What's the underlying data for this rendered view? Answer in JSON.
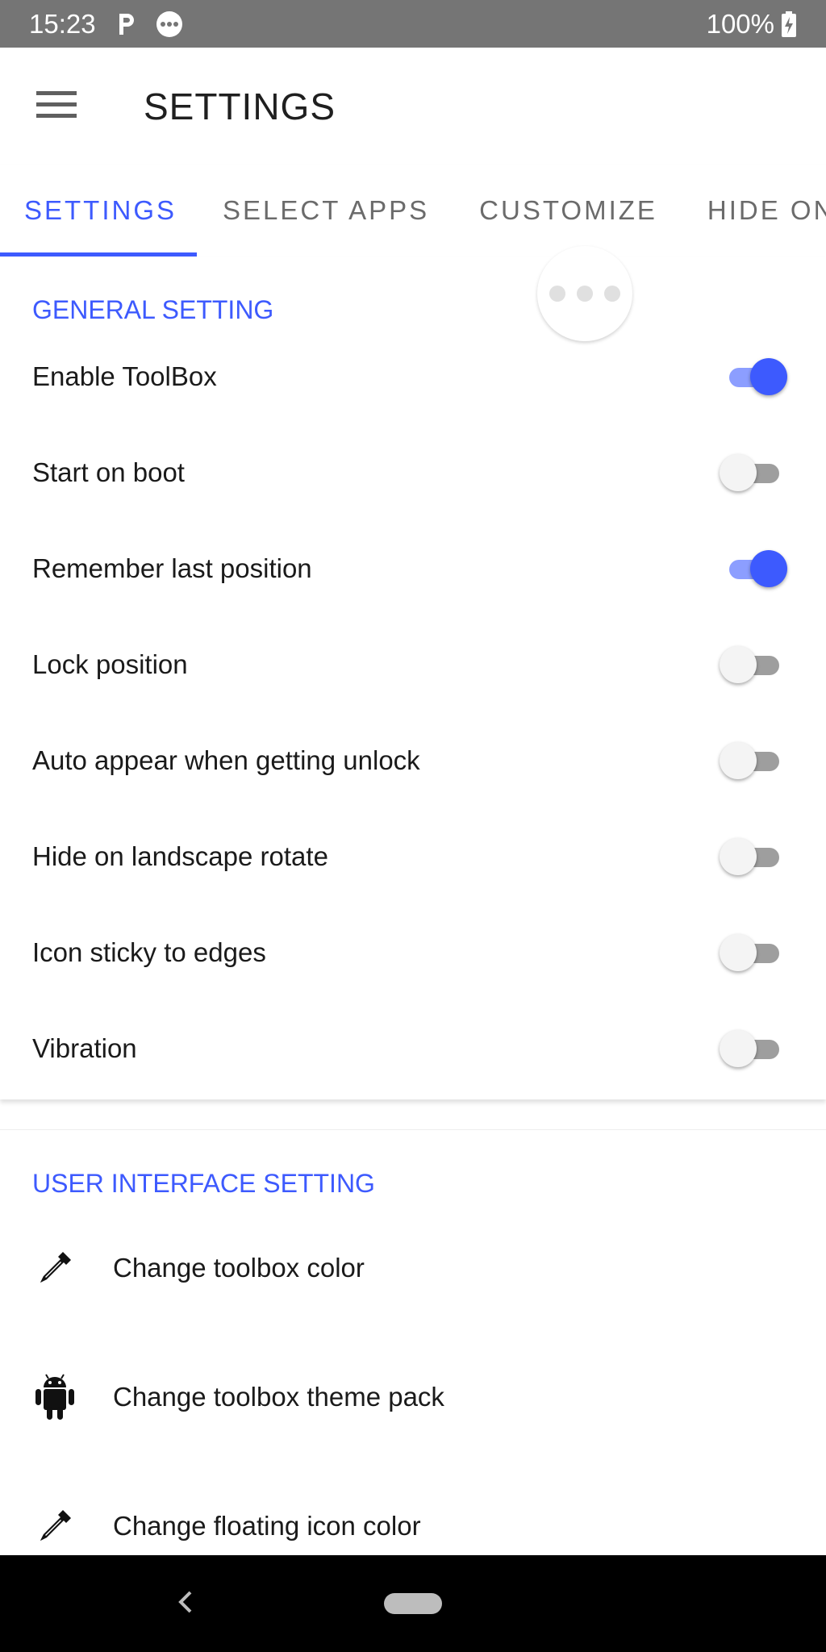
{
  "status_bar": {
    "time": "15:23",
    "battery": "100%",
    "icons": [
      "parking-icon",
      "more-dots-icon",
      "battery-charging-icon"
    ]
  },
  "app_bar": {
    "title": "SETTINGS",
    "menu_icon": "hamburger-menu-icon"
  },
  "tabs": [
    {
      "label": "SETTINGS",
      "active": true
    },
    {
      "label": "SELECT APPS",
      "active": false
    },
    {
      "label": "CUSTOMIZE",
      "active": false
    },
    {
      "label": "HIDE ON",
      "active": false
    }
  ],
  "general": {
    "title": "GENERAL SETTING",
    "items": [
      {
        "label": "Enable ToolBox",
        "on": true
      },
      {
        "label": "Start on boot",
        "on": false
      },
      {
        "label": "Remember last position",
        "on": true
      },
      {
        "label": "Lock position",
        "on": false
      },
      {
        "label": "Auto appear when getting unlock",
        "on": false
      },
      {
        "label": "Hide on landscape rotate",
        "on": false
      },
      {
        "label": "Icon sticky to edges",
        "on": false
      },
      {
        "label": "Vibration",
        "on": false
      }
    ]
  },
  "ui": {
    "title": "USER INTERFACE SETTING",
    "items": [
      {
        "label": "Change toolbox color",
        "icon": "eyedropper-icon"
      },
      {
        "label": "Change toolbox theme pack",
        "icon": "android-icon"
      },
      {
        "label": "Change floating icon color",
        "icon": "eyedropper-icon"
      }
    ]
  },
  "colors": {
    "accent": "#3d5afe",
    "accent_light": "#8c9eff",
    "status_bar": "#757575",
    "nav_bar": "#000000"
  }
}
